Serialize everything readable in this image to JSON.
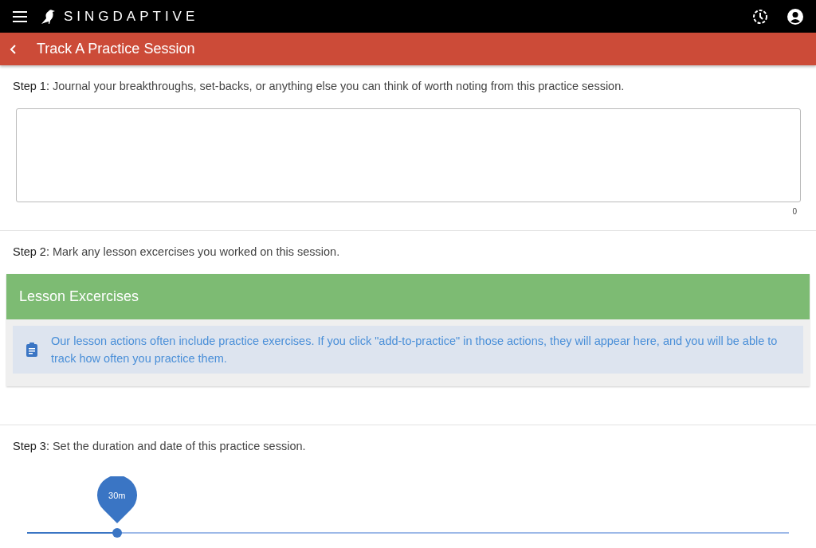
{
  "app_bar": {
    "brand": "SINGDAPTIVE"
  },
  "title_bar": {
    "title": "Track A Practice Session"
  },
  "steps": [
    {
      "kind": "journal",
      "label": "Step 1:",
      "text": "Journal your breakthroughs, set-backs, or anything else you can think of worth noting from this practice session.",
      "counter": "0"
    },
    {
      "kind": "exercises",
      "label": "Step 2:",
      "text": "Mark any lesson excercises you worked on this session.",
      "panel_title": "Lesson Excercises",
      "info": "Our lesson actions often include practice exercises. If you click \"add-to-practice\" in those actions, they will appear here, and you will be able to track how often you practice them."
    },
    {
      "kind": "duration",
      "label": "Step 3:",
      "text": "Set the duration and date of this practice session.",
      "slider": {
        "reading": "30m",
        "level": 0.118
      }
    }
  ]
}
